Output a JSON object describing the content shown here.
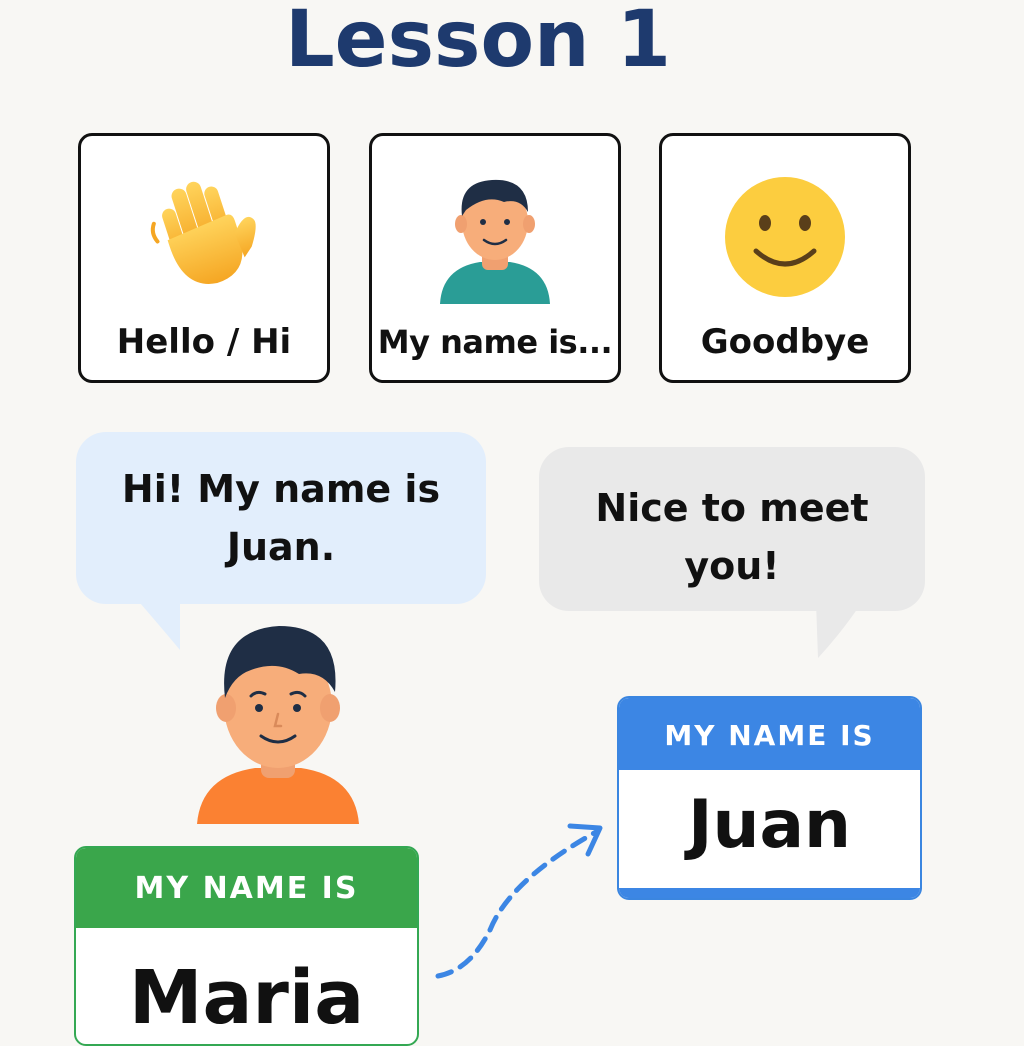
{
  "title": "Lesson 1",
  "cards": [
    {
      "label": "Hello / Hi",
      "icon": "waving-hand-icon"
    },
    {
      "label": "My name is...",
      "icon": "person-icon"
    },
    {
      "label": "Goodbye",
      "icon": "smiley-face-icon"
    }
  ],
  "dialogue": {
    "left_bubble": {
      "line1": "Hi! My name is",
      "line2": "Juan."
    },
    "right_bubble": {
      "line1": "Nice to meet",
      "line2": "you!"
    }
  },
  "name_tags": {
    "maria": {
      "header": "MY NAME IS",
      "name": "Maria",
      "color": "#3aa64b"
    },
    "juan": {
      "header": "MY NAME IS",
      "name": "Juan",
      "color": "#3c86e4"
    }
  },
  "colors": {
    "title": "#1e3a6e",
    "left_bubble": "#e2eefc",
    "right_bubble": "#e9e9e9",
    "arrow": "#3c86e4"
  }
}
